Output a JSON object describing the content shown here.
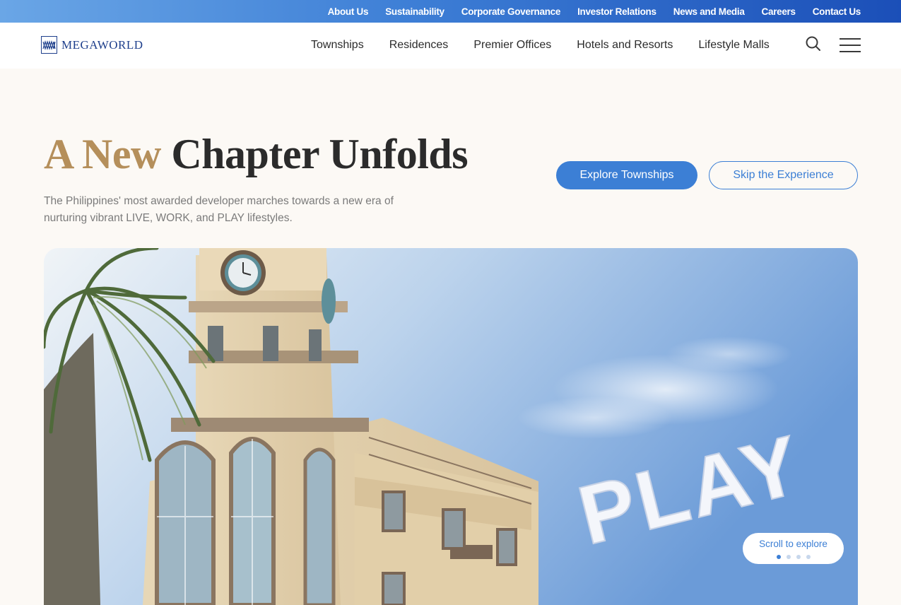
{
  "top_links": [
    "About Us",
    "Sustainability",
    "Corporate Governance",
    "Investor Relations",
    "News and Media",
    "Careers",
    "Contact Us"
  ],
  "brand": {
    "name": "MEGAWORLD"
  },
  "nav": [
    "Townships",
    "Residences",
    "Premier Offices",
    "Hotels and Resorts",
    "Lifestyle Malls"
  ],
  "icons": {
    "search": "search-icon",
    "menu": "hamburger-menu-icon",
    "logo": "megaworld-logo-icon"
  },
  "hero": {
    "title_accent": "A New",
    "title_rest": "Chapter Unfolds",
    "description": "The Philippines' most awarded developer marches towards a new era of nurturing vibrant LIVE, WORK, and PLAY lifestyles.",
    "primary_button": "Explore Townships",
    "secondary_button": "Skip the Experience",
    "video_caption": "PLAY",
    "scroll_label": "Scroll to explore",
    "carousel": {
      "count": 4,
      "active": 1
    }
  },
  "colors": {
    "accent": "#3c7fd5",
    "gold": "#b58f5b",
    "navy": "#1e3f8c",
    "background": "#fcf9f5"
  }
}
